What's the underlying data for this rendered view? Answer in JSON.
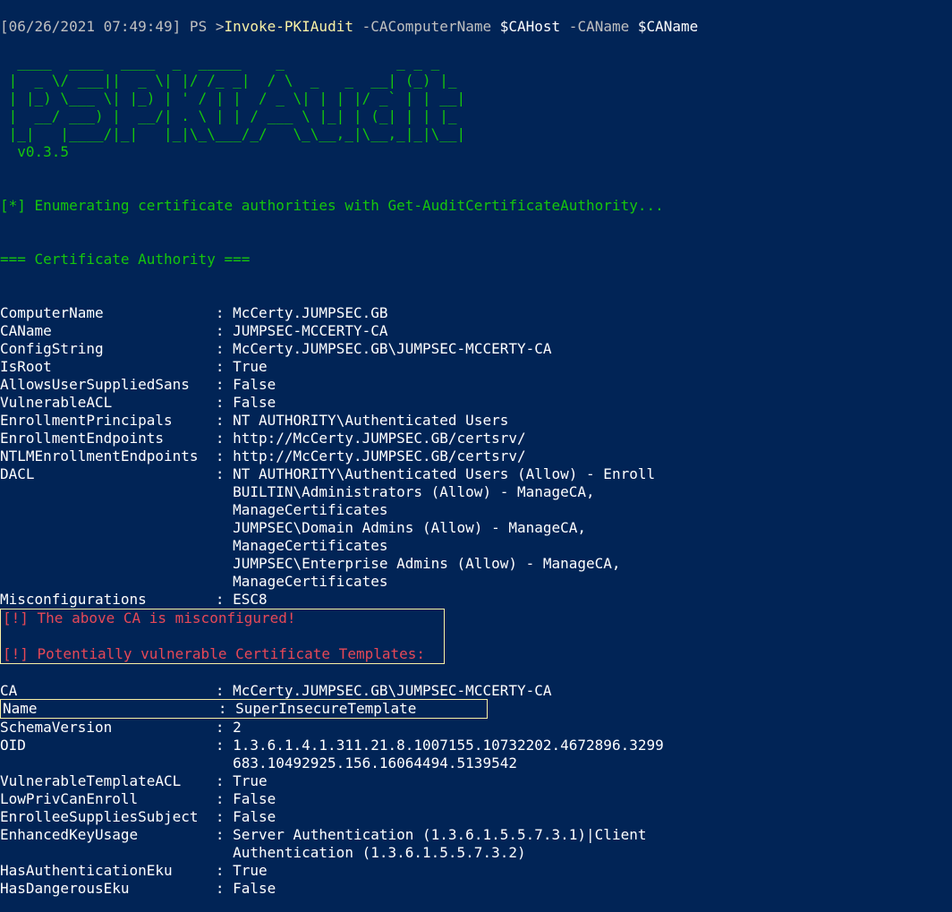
{
  "prompt": {
    "timestamp": "[06/26/2021 07:49:49]",
    "ps": " PS >",
    "cmd": "Invoke-PKIAudit",
    "arg1": " -CAComputerName ",
    "val1": "$CAHost",
    "arg2": " -CAName ",
    "val2": "$CAName"
  },
  "banner": {
    "l1": "  ____  ____  ____  _  _____    _             _ _ _",
    "l2": " |  _ \\/ ___||  _ \\| |/ /_ _|  / \\  _   _  __| (_) |_",
    "l3": " | |_) \\___ \\| |_) | ' / | |  / _ \\| | | |/ _` | | __|",
    "l4": " |  __/ ___) |  __/| . \\ | | / ___ \\ |_| | (_| | | |_",
    "l5": " |_|   |____/|_|   |_|\\_\\___/_/   \\_\\__,_|\\__,_|_|\\__|",
    "version": "  v0.3.5"
  },
  "status": {
    "enum": "[*] Enumerating certificate authorities with Get-AuditCertificateAuthority...",
    "section": "=== Certificate Authority ==="
  },
  "ca": {
    "ComputerName": {
      "k": "ComputerName            ",
      "v": "McCerty.JUMPSEC.GB"
    },
    "CAName": {
      "k": "CAName                  ",
      "v": "JUMPSEC-MCCERTY-CA"
    },
    "ConfigString": {
      "k": "ConfigString            ",
      "v": "McCerty.JUMPSEC.GB\\JUMPSEC-MCCERTY-CA"
    },
    "IsRoot": {
      "k": "IsRoot                  ",
      "v": "True"
    },
    "AllowsUserSuppliedSans": {
      "k": "AllowsUserSuppliedSans  ",
      "v": "False"
    },
    "VulnerableACL": {
      "k": "VulnerableACL           ",
      "v": "False"
    },
    "EnrollmentPrincipals": {
      "k": "EnrollmentPrincipals    ",
      "v": "NT AUTHORITY\\Authenticated Users"
    },
    "EnrollmentEndpoints": {
      "k": "EnrollmentEndpoints     ",
      "v": "http://McCerty.JUMPSEC.GB/certsrv/"
    },
    "NTLMEnrollmentEndpoints": {
      "k": "NTLMEnrollmentEndpoints ",
      "v": "http://McCerty.JUMPSEC.GB/certsrv/"
    },
    "DACL": {
      "k": "DACL                    ",
      "v1": "NT AUTHORITY\\Authenticated Users (Allow) - Enroll",
      "v2": "                           BUILTIN\\Administrators (Allow) - ManageCA,",
      "v3": "                           ManageCertificates",
      "v4": "                           JUMPSEC\\Domain Admins (Allow) - ManageCA,",
      "v5": "                           ManageCertificates",
      "v6": "                           JUMPSEC\\Enterprise Admins (Allow) - ManageCA,",
      "v7": "                           ManageCertificates"
    },
    "Misconfigurations": {
      "k": "Misconfigurations       ",
      "v": "ESC8"
    }
  },
  "alerts": {
    "l1": "[!] The above CA is misconfigured!",
    "l2": "[!] Potentially vulnerable Certificate Templates:"
  },
  "tpl": {
    "CA": {
      "k": "CA                      ",
      "v": "McCerty.JUMPSEC.GB\\JUMPSEC-MCCERTY-CA"
    },
    "Name": {
      "k": "Name                    ",
      "sep": " : ",
      "v": "SuperInsecureTemplate"
    },
    "SchemaVersion": {
      "k": "SchemaVersion           ",
      "v": "2"
    },
    "OID": {
      "k": "OID                     ",
      "v1": "1.3.6.1.4.1.311.21.8.1007155.10732202.4672896.3299",
      "v2": "                           683.10492925.156.16064494.5139542"
    },
    "VulnerableTemplateACL": {
      "k": "VulnerableTemplateACL   ",
      "v": "True"
    },
    "LowPrivCanEnroll": {
      "k": "LowPrivCanEnroll        ",
      "v": "False"
    },
    "EnrolleeSuppliesSubject": {
      "k": "EnrolleeSuppliesSubject ",
      "v": "False"
    },
    "EnhancedKeyUsage": {
      "k": "EnhancedKeyUsage        ",
      "v1": "Server Authentication (1.3.6.1.5.5.7.3.1)|Client",
      "v2": "                           Authentication (1.3.6.1.5.5.7.3.2)"
    },
    "HasAuthenticationEku": {
      "k": "HasAuthenticationEku    ",
      "v": "True"
    },
    "HasDangerousEku": {
      "k": "HasDangerousEku         ",
      "v": "False"
    }
  },
  "sep": " : "
}
